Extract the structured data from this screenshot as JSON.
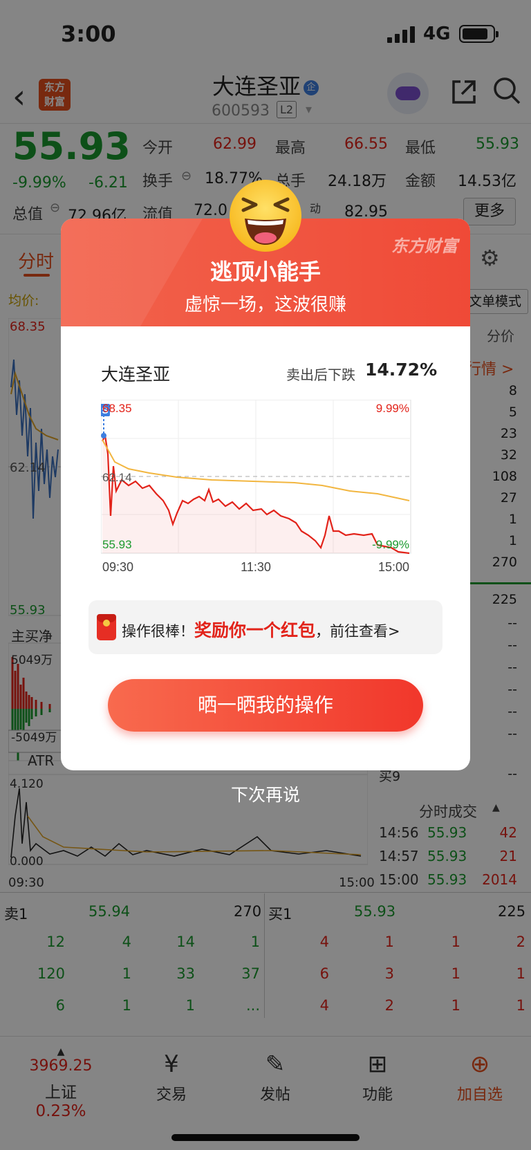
{
  "status_bar": {
    "time": "3:00",
    "network": "4G"
  },
  "header": {
    "logo_text_1": "东方",
    "logo_text_2": "财富",
    "stock_name": "大连圣亚",
    "qiye_badge": "企",
    "code": "600593",
    "level": "L2"
  },
  "quote": {
    "price": "55.93",
    "pct": "-9.99%",
    "change": "-6.21",
    "stats": [
      {
        "label": "今开",
        "value": "62.99",
        "color": "red"
      },
      {
        "label": "最高",
        "value": "66.55",
        "color": "red"
      },
      {
        "label": "最低",
        "value": "55.93",
        "color": "green"
      },
      {
        "label": "换手",
        "value": "18.77%",
        "color": "dark"
      },
      {
        "label": "总手",
        "value": "24.18万",
        "color": "dark"
      },
      {
        "label": "金额",
        "value": "14.53亿",
        "color": "dark"
      },
      {
        "label": "总值",
        "value": "72.96亿",
        "color": "dark"
      },
      {
        "label": "流值",
        "value": "72.0",
        "color": "dark"
      },
      {
        "label": "动",
        "value": "82.95",
        "color": "dark"
      }
    ],
    "more_label": "更多"
  },
  "tabs": {
    "active": "分时",
    "avg_label": "均价:",
    "mode_button": "文单模式",
    "fenjia": "分价",
    "hangqing": "行情 >"
  },
  "bg_chart": {
    "high": "68.35",
    "prev_close": "62.14",
    "low": "55.93",
    "flow_label": "主买净",
    "flow_top": "5049万",
    "flow_bottom": "-5049万",
    "atr_label": "ATR",
    "atr_top": "4.120",
    "atr_bottom": "0.000",
    "time_start": "09:30",
    "time_end": "15:00"
  },
  "right_col": {
    "values": [
      "8",
      "5",
      "23",
      "32",
      "108",
      "27",
      "1",
      "1",
      "270"
    ],
    "buy1_vol": "225",
    "dashes": [
      "--",
      "--",
      "--",
      "--",
      "--",
      "--",
      "--"
    ],
    "mai9_label": "买9",
    "mai9_vol": "--",
    "trades_title": "分时成交",
    "trades": [
      {
        "time": "14:56",
        "price": "55.93",
        "vol": "42"
      },
      {
        "time": "14:57",
        "price": "55.93",
        "vol": "21"
      },
      {
        "time": "15:00",
        "price": "55.93",
        "vol": "2014"
      }
    ]
  },
  "order_book": {
    "sell1": {
      "label": "卖1",
      "price": "55.94",
      "vol": "270"
    },
    "buy1": {
      "label": "买1",
      "price": "55.93",
      "vol": "225"
    },
    "sell_rows": [
      [
        "12",
        "4",
        "14",
        "1"
      ],
      [
        "120",
        "1",
        "33",
        "37"
      ],
      [
        "6",
        "1",
        "1",
        "..."
      ]
    ],
    "buy_rows": [
      [
        "4",
        "1",
        "1",
        "2"
      ],
      [
        "6",
        "3",
        "1",
        "1"
      ],
      [
        "4",
        "2",
        "1",
        "1"
      ]
    ]
  },
  "bottom_nav": {
    "index_value": "3969.25",
    "index_name": "上证",
    "index_pct": "0.23%",
    "items": [
      "交易",
      "发帖",
      "功能",
      "加自选"
    ]
  },
  "modal": {
    "brand_watermark": "东方财富",
    "title": "逃顶小能手",
    "subtitle": "虚惊一场，这波很赚",
    "stock_name": "大连圣亚",
    "drop_label": "卖出后下跌",
    "drop_value": "14.72%",
    "chart_high": "68.35",
    "chart_high_pct": "9.99%",
    "chart_prev": "62.14",
    "chart_low": "55.93",
    "chart_low_pct": "-9.99%",
    "chart_sell_marker": "S",
    "time_labels": [
      "09:30",
      "11:30",
      "15:00"
    ],
    "redpacket_prefix": "操作很棒！",
    "redpacket_highlight": "奖励你一个红包",
    "redpacket_suffix": "，前往查看>",
    "share_button": "晒一晒我的操作",
    "dismiss": "下次再说"
  }
}
